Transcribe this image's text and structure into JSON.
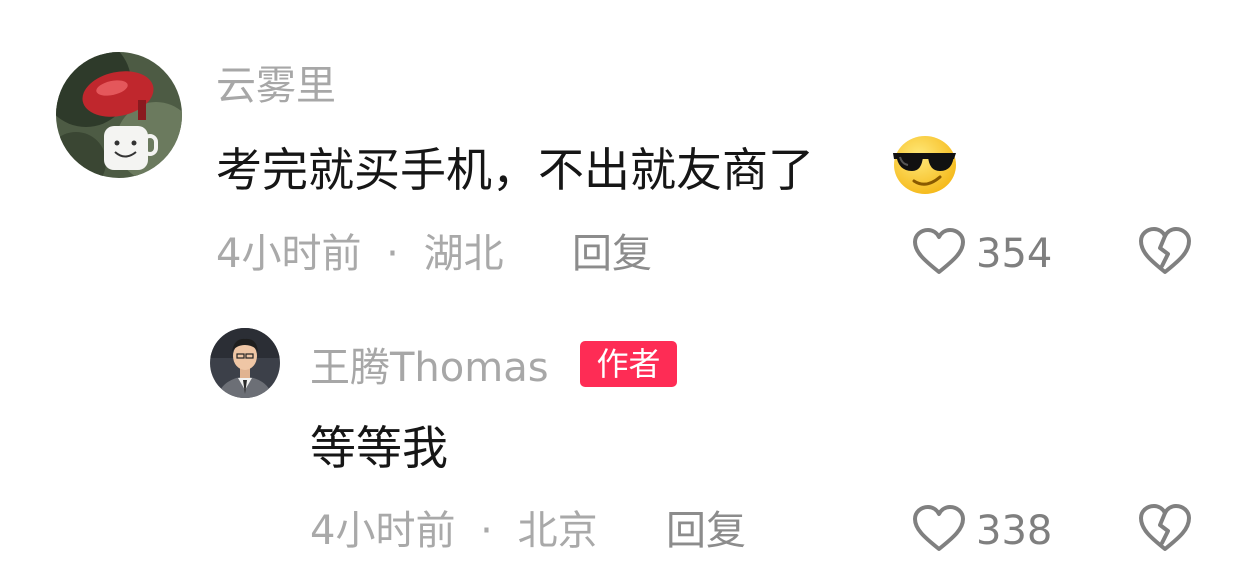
{
  "comments": [
    {
      "username": "云雾里",
      "text": "考完就买手机，不出就友商了",
      "emoji": "sunglasses-emoji",
      "time": "4小时前",
      "separator": "·",
      "location": "湖北",
      "reply_label": "回复",
      "like_count": "354"
    }
  ],
  "reply": {
    "username": "王腾Thomas",
    "badge": "作者",
    "text": "等等我",
    "time": "4小时前",
    "separator": "·",
    "location": "北京",
    "reply_label": "回复",
    "like_count": "338"
  },
  "colors": {
    "username": "#a7a7a7",
    "badge_bg": "#fe2c55",
    "meta": "#a9a9a9",
    "icon": "#808080"
  }
}
